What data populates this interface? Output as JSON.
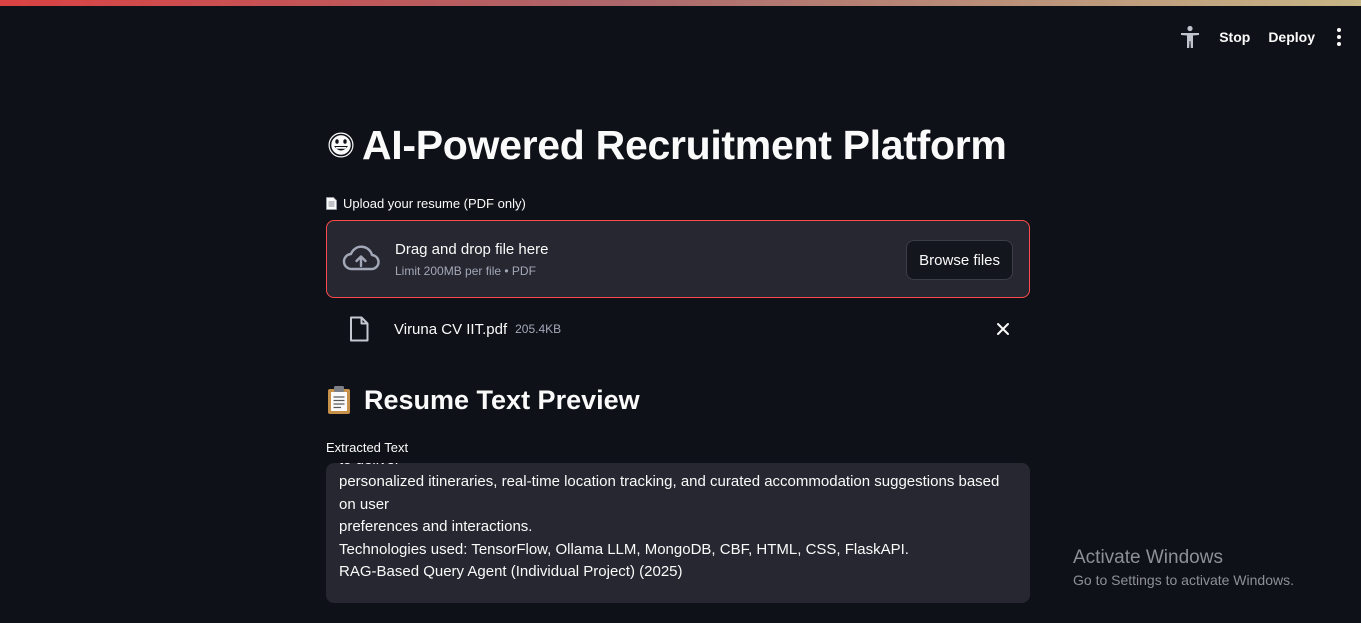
{
  "toolbar": {
    "stop_label": "Stop",
    "deploy_label": "Deploy"
  },
  "page": {
    "title": "AI-Powered Recruitment Platform"
  },
  "uploader": {
    "label": "Upload your resume (PDF only)",
    "drop_title": "Drag and drop file here",
    "drop_subtitle": "Limit 200MB per file • PDF",
    "browse_label": "Browse files"
  },
  "uploaded_file": {
    "name": "Viruna CV IIT.pdf",
    "size": "205.4KB"
  },
  "preview": {
    "heading": "Resume Text Preview",
    "field_label": "Extracted Text",
    "text": "to deliver\npersonalized itineraries, real-time location tracking, and curated accommodation suggestions based on user\npreferences and interactions.\nTechnologies used: TensorFlow, Ollama LLM, MongoDB, CBF, HTML, CSS, FlaskAPI.\nRAG-Based Query Agent (Individual Project) (2025)"
  },
  "watermark": {
    "title": "Activate Windows",
    "subtitle": "Go to Settings to activate Windows."
  },
  "colors": {
    "background": "#0e1117",
    "surface": "#262730",
    "accent": "#ff4b4b",
    "muted_text": "#a3a8b8"
  },
  "icons": {
    "accessibility": "accessibility-icon",
    "menu": "kebab-menu-icon",
    "title": "grinning-face-icon",
    "upload_label": "page-facing-up-icon",
    "cloud": "cloud-upload-icon",
    "file": "file-icon",
    "remove": "close-icon",
    "section": "clipboard-icon"
  }
}
